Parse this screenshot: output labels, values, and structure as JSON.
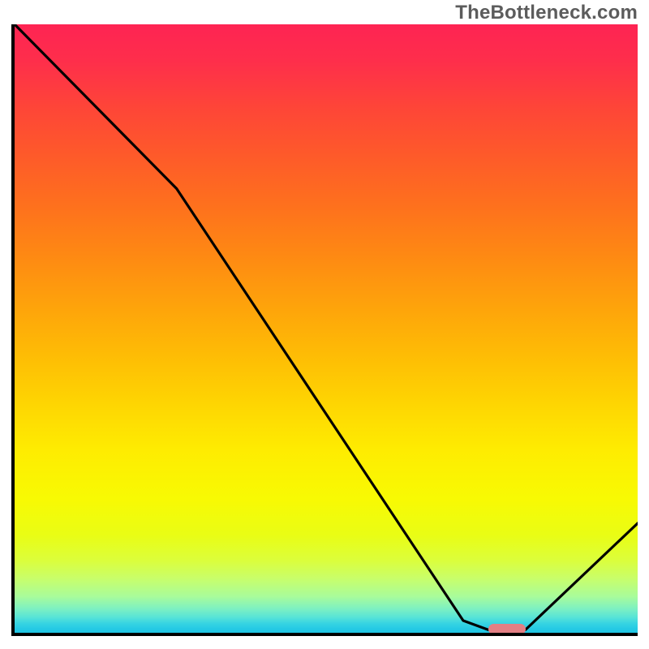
{
  "watermark": "TheBottleneck.com",
  "chart_data": {
    "type": "line",
    "title": "",
    "xlabel": "",
    "ylabel": "",
    "xlim": [
      0,
      100
    ],
    "ylim": [
      0,
      100
    ],
    "grid": false,
    "legend": false,
    "series": [
      {
        "name": "bottleneck-curve",
        "x": [
          0,
          26,
          72,
          76,
          82,
          100
        ],
        "values": [
          100,
          73,
          2,
          0.5,
          0.5,
          18
        ]
      }
    ],
    "marker": {
      "x_start": 76,
      "x_end": 82,
      "y": 0.7
    },
    "background": "rainbow-vertical-gradient",
    "gradient_stops": [
      {
        "pos": 0,
        "color": "#fe2453"
      },
      {
        "pos": 14,
        "color": "#fe4637"
      },
      {
        "pos": 30,
        "color": "#fe711d"
      },
      {
        "pos": 46,
        "color": "#fea20b"
      },
      {
        "pos": 62,
        "color": "#fed402"
      },
      {
        "pos": 78,
        "color": "#f8fa03"
      },
      {
        "pos": 88,
        "color": "#dcfe3a"
      },
      {
        "pos": 94,
        "color": "#a9fc9a"
      },
      {
        "pos": 98,
        "color": "#36d4e2"
      },
      {
        "pos": 100,
        "color": "#1fc5e4"
      }
    ]
  }
}
